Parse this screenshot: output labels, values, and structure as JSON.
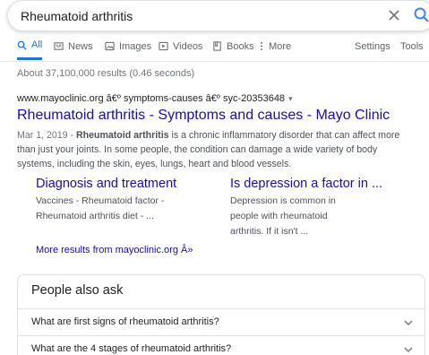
{
  "search": {
    "query": "Rheumatoid arthritis"
  },
  "tabs": [
    {
      "label": "All",
      "icon": "search-icon"
    },
    {
      "label": "News",
      "icon": "news-icon"
    },
    {
      "label": "Images",
      "icon": "image-icon"
    },
    {
      "label": "Videos",
      "icon": "video-icon"
    },
    {
      "label": "Books",
      "icon": "book-icon"
    },
    {
      "label": "More",
      "icon": "more-vert-icon"
    }
  ],
  "tools": {
    "settings": "Settings",
    "tools": "Tools"
  },
  "stats": "About 37,100,000 results (0.46 seconds)",
  "result": {
    "cite": "www.mayoclinic.org â€º symptoms-causes â€º syc-20353648",
    "title": "Rheumatoid arthritis - Symptoms and causes - Mayo Clinic",
    "date": "Mar 1, 2019 - ",
    "snippet_bold": "Rheumatoid arthritis",
    "snippet_rest": " is a chronic inflammatory disorder that can affect more than just your joints. In some people, the condition can damage a wide variety of body systems, including the skin, eyes, lungs, heart and blood vessels."
  },
  "sitelinks": [
    {
      "title": "Diagnosis and treatment",
      "desc_line1": "Vaccines - Rheumatoid factor -",
      "desc_line2": "Rheumatoid arthritis diet - ..."
    },
    {
      "title": "Is depression a factor in ...",
      "desc_line1": "Depression is common in",
      "desc_line2": "people with rheumatoid",
      "desc_line3": "arthritis. If it isn't ..."
    }
  ],
  "more_results": "More results from mayoclinic.org Â»",
  "people_also_ask": {
    "title": "People also ask",
    "questions": [
      "What are first signs of rheumatoid arthritis?",
      "What are the 4 stages of rheumatoid arthritis?"
    ]
  },
  "colors": {
    "link": "#1a0dab",
    "accent": "#1a73e8",
    "text": "#202124",
    "muted": "#70757a"
  }
}
